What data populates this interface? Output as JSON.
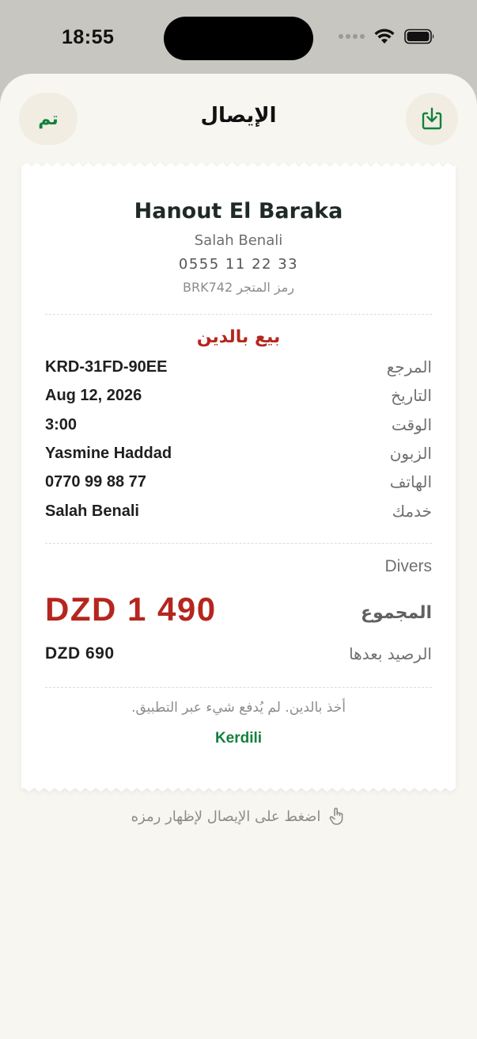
{
  "status_bar": {
    "time": "18:55"
  },
  "nav": {
    "done_label": "تم",
    "title": "الإيصال"
  },
  "receipt": {
    "shop_name": "Hanout El Baraka",
    "owner": "Salah Benali",
    "phone": "0555 11 22 33",
    "store_code_label": "رمز المتجر",
    "store_code": "BRK742",
    "sale_type": "بيع بالدين",
    "details": [
      {
        "label": "المرجع",
        "value": "KRD-31FD-90EE"
      },
      {
        "label": "التاريخ",
        "value": "Aug 12, 2026"
      },
      {
        "label": "الوقت",
        "value": "3:00"
      },
      {
        "label": "الزبون",
        "value": "Yasmine Haddad"
      },
      {
        "label": "الهاتف",
        "value": "0770 99 88 77"
      },
      {
        "label": "خدمك",
        "value": "Salah Benali"
      }
    ],
    "category": "Divers",
    "total_label": "المجموع",
    "total_amount": "DZD 1 490",
    "balance_label": "الرصيد بعدها",
    "balance_amount": "DZD 690",
    "footer_note": "أخذ بالدين. لم يُدفع شيء عبر التطبيق.",
    "brand": "Kerdili"
  },
  "hint": {
    "text": "اضغط على الإيصال لإظهار رمزه"
  },
  "colors": {
    "accent_green": "#12813c",
    "accent_red": "#b5261e",
    "sheet_bg": "#f8f6f0"
  }
}
